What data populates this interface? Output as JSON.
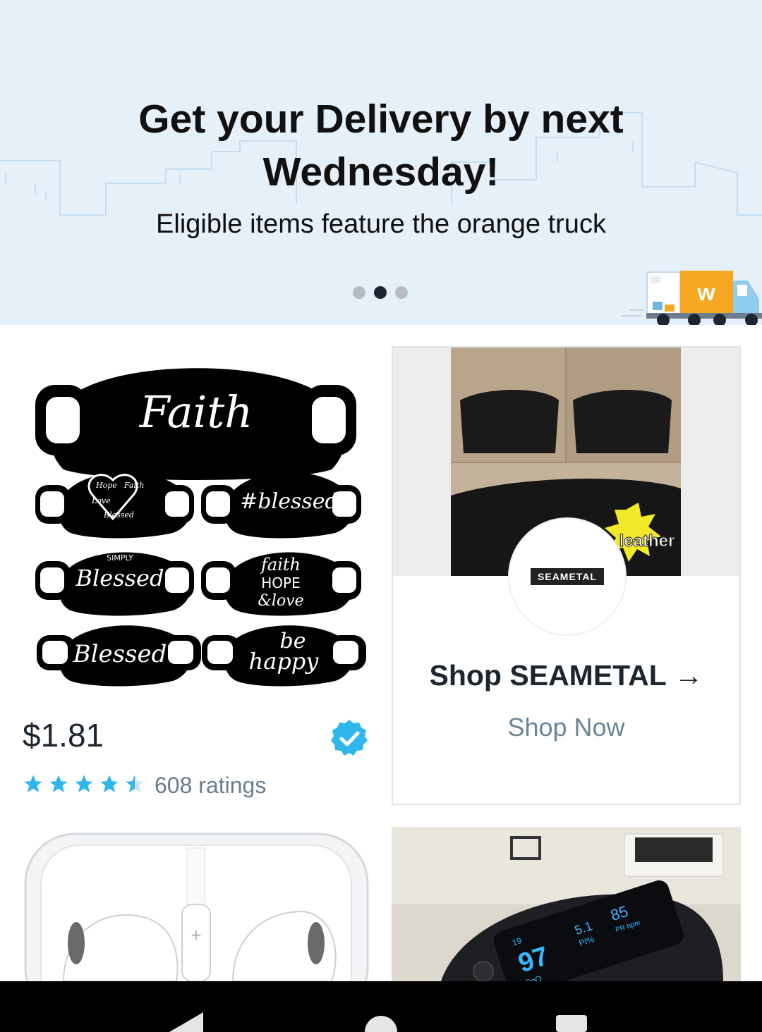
{
  "banner": {
    "title": "Get your Delivery by next Wednesday!",
    "subtitle": "Eligible items feature the orange truck",
    "pager": {
      "count": 3,
      "active": 1
    },
    "truck_logo": "w"
  },
  "products": [
    {
      "image_name": "face-masks-image",
      "image_text": [
        "Faith",
        "#blessed",
        "Hope",
        "Faith",
        "Love",
        "Blessed",
        "SIMPLY",
        "Blessed",
        "faith",
        "HOPE",
        "&love",
        "Blessed",
        "be",
        "happy"
      ],
      "price": "$1.81",
      "verified": true,
      "rating": 4.5,
      "ratings_text": "608 ratings"
    }
  ],
  "store": {
    "banner_text": "leather",
    "logo_text": "SEAMETAL",
    "name": "Shop SEAMETAL",
    "arrow": "→",
    "cta": "Shop Now"
  },
  "lower_products": [
    {
      "image_name": "earphones-image"
    },
    {
      "image_name": "pulse-oximeter-image",
      "display": {
        "spo2": "97",
        "pr": "85",
        "pi": "5.1",
        "spo2_label": "SpO",
        "pi_label": "PI%",
        "pr_label": "PR bpm",
        "small": "19"
      }
    }
  ],
  "colors": {
    "accent_blue": "#2fb7ec",
    "star": "#2fb7ec",
    "truck_orange": "#f7a823",
    "banner_bg": "#e6f0f8"
  },
  "icons": [
    "verified-check-icon",
    "star-icon",
    "arrow-right-icon",
    "nav-back-icon",
    "nav-home-icon",
    "nav-recents-icon"
  ]
}
